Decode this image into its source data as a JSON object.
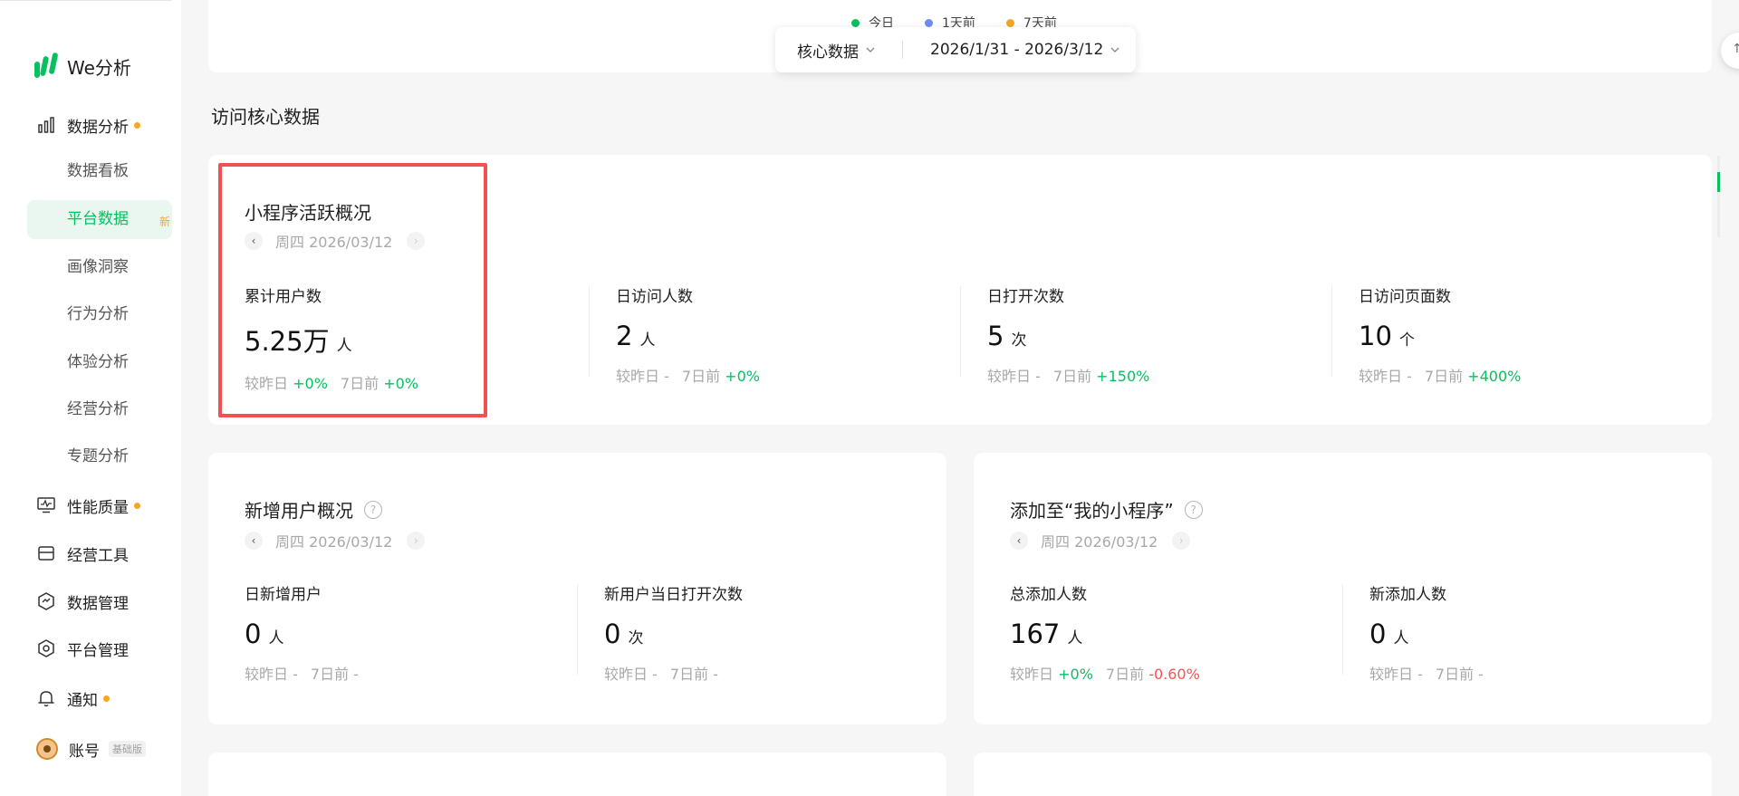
{
  "app": {
    "logo_text": "We分析"
  },
  "sidebar": {
    "groups": [
      {
        "label": "数据分析",
        "icon": "bar-chart-icon"
      },
      {
        "label": "性能质量",
        "icon": "monitor-icon"
      },
      {
        "label": "经营工具",
        "icon": "toolbox-icon"
      },
      {
        "label": "数据管理",
        "icon": "data-shield-icon"
      },
      {
        "label": "平台管理",
        "icon": "hexagon-icon"
      },
      {
        "label": "通知",
        "icon": "bell-icon"
      },
      {
        "label": "账号",
        "icon": "avatar",
        "badge": "基础版"
      }
    ],
    "sub_items": [
      "数据看板",
      "平台数据",
      "画像洞察",
      "行为分析",
      "体验分析",
      "经营分析",
      "专题分析"
    ],
    "new_tag": "新"
  },
  "legend": [
    {
      "label": "今日",
      "color": "#07c160"
    },
    {
      "label": "1天前",
      "color": "#6b8ef6"
    },
    {
      "label": "7天前",
      "color": "#f6a623"
    }
  ],
  "filter": {
    "category": "核心数据",
    "date_range": "2026/1/31 - 2026/3/12"
  },
  "section_title": "访问核心数据",
  "core_card": {
    "title": "小程序活跃概况",
    "date": "周四 2026/03/12",
    "metrics": [
      {
        "label": "累计用户数",
        "value": "5.25万",
        "unit": "人",
        "c1_label": "较昨日",
        "c1_val": "+0%",
        "c2_label": "7日前",
        "c2_val": "+0%"
      },
      {
        "label": "日访问人数",
        "value": "2",
        "unit": "人",
        "c1_label": "较昨日",
        "c1_val": "-",
        "c2_label": "7日前",
        "c2_val": "+0%"
      },
      {
        "label": "日打开次数",
        "value": "5",
        "unit": "次",
        "c1_label": "较昨日",
        "c1_val": "-",
        "c2_label": "7日前",
        "c2_val": "+150%"
      },
      {
        "label": "日访问页面数",
        "value": "10",
        "unit": "个",
        "c1_label": "较昨日",
        "c1_val": "-",
        "c2_label": "7日前",
        "c2_val": "+400%"
      }
    ]
  },
  "new_users_card": {
    "title": "新增用户概况",
    "date": "周四 2026/03/12",
    "metrics": [
      {
        "label": "日新增用户",
        "value": "0",
        "unit": "人",
        "c1_label": "较昨日",
        "c1_val": "-",
        "c2_label": "7日前",
        "c2_val": "-"
      },
      {
        "label": "新用户当日打开次数",
        "value": "0",
        "unit": "次",
        "c1_label": "较昨日",
        "c1_val": "-",
        "c2_label": "7日前",
        "c2_val": "-"
      }
    ]
  },
  "add_card": {
    "title": "添加至“我的小程序”",
    "date": "周四 2026/03/12",
    "metrics": [
      {
        "label": "总添加人数",
        "value": "167",
        "unit": "人",
        "c1_label": "较昨日",
        "c1_val": "+0%",
        "c2_label": "7日前",
        "c2_val": "-0.60%"
      },
      {
        "label": "新添加人数",
        "value": "0",
        "unit": "人",
        "c1_label": "较昨日",
        "c1_val": "-",
        "c2_label": "7日前",
        "c2_val": "-"
      }
    ]
  }
}
